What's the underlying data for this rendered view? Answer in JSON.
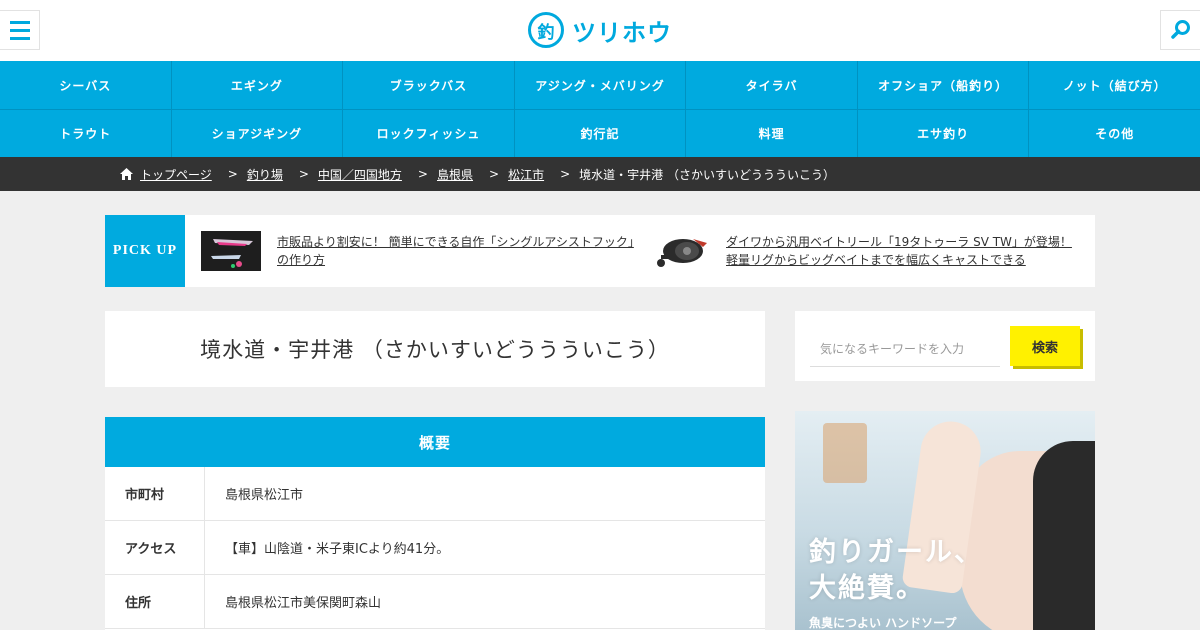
{
  "header": {
    "logo_mark": "釣",
    "logo_text": "ツリホウ"
  },
  "nav": {
    "row1": [
      "シーバス",
      "エギング",
      "ブラックバス",
      "アジング・メバリング",
      "タイラバ",
      "オフショア（船釣り）",
      "ノット（結び方）"
    ],
    "row2": [
      "トラウト",
      "ショアジギング",
      "ロックフィッシュ",
      "釣行記",
      "料理",
      "エサ釣り",
      "その他"
    ]
  },
  "breadcrumb": {
    "items": [
      "トップページ",
      "釣り場",
      "中国／四国地方",
      "島根県",
      "松江市"
    ],
    "current": "境水道・宇井港 （さかいすいどううういこう）",
    "separator": ">"
  },
  "pickup": {
    "label": "PICK UP",
    "items": [
      {
        "title": "市販品より割安に！ 簡単にできる自作「シングルアシストフック」の作り方"
      },
      {
        "title": "ダイワから汎用ベイトリール「19タトゥーラ SV TW」が登場！軽量リグからビッグベイトまでを幅広くキャストできる"
      }
    ]
  },
  "page": {
    "title": "境水道・宇井港 （さかいすいどううういこう）"
  },
  "overview": {
    "heading": "概要",
    "rows": [
      {
        "key": "市町村",
        "value": "島根県松江市"
      },
      {
        "key": "アクセス",
        "value": "【車】山陰道・米子東ICより約41分。"
      },
      {
        "key": "住所",
        "value": "島根県松江市美保関町森山"
      }
    ]
  },
  "search": {
    "placeholder": "気になるキーワードを入力",
    "button": "検索"
  },
  "ad": {
    "headline_1": "釣りガール、",
    "headline_2": "大絶賛。",
    "sub": "魚臭につよい ハンドソープ"
  },
  "colors": {
    "accent": "#00aadf",
    "breadcrumb_bg": "#333333",
    "search_button": "#fff100"
  },
  "icons": {
    "menu": "hamburger-menu-icon",
    "search": "magnifier-icon",
    "home": "home-icon"
  }
}
